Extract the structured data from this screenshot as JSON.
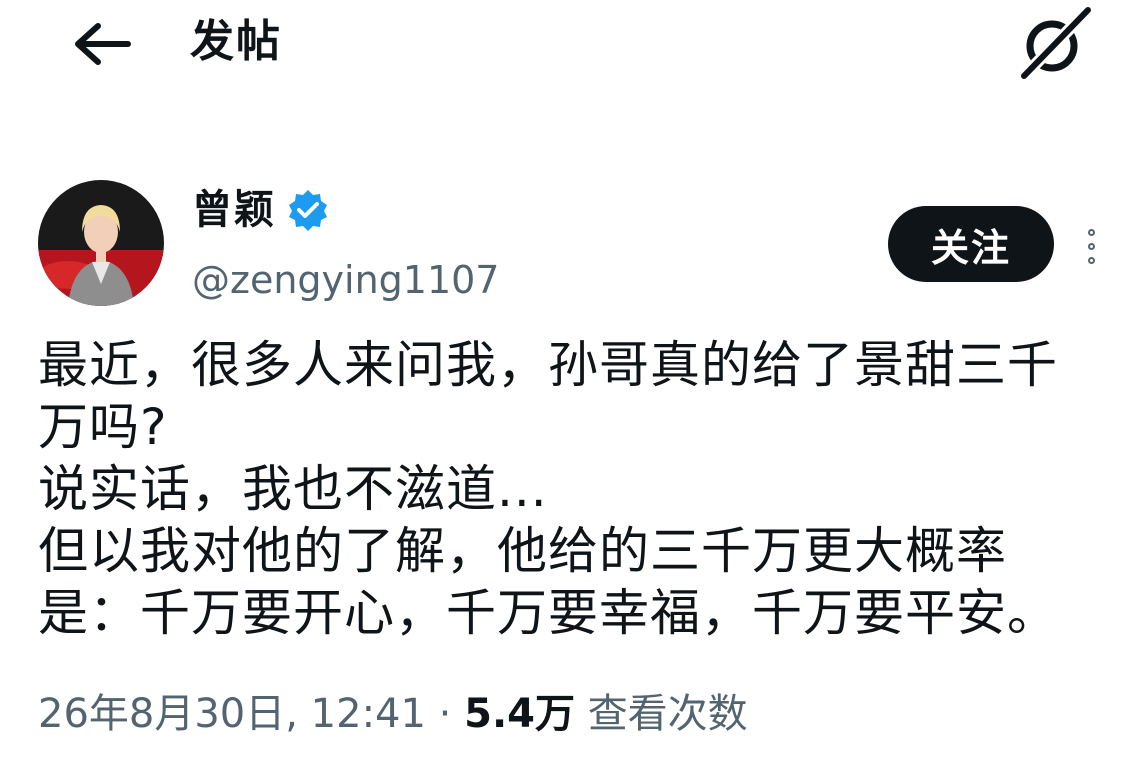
{
  "header": {
    "title": "发帖",
    "icons": {
      "back": "arrow-left-icon",
      "grok": "grok-icon"
    }
  },
  "author": {
    "name": "曾颖",
    "handle": "@zengying1107",
    "verified": true,
    "follow_label": "关注"
  },
  "post": {
    "lines": [
      "最近，很多人来问我，孙哥真的给了景甜三千",
      "万吗?",
      "说实话，我也不滋道...",
      "但以我对他的了解，他给的三千万更大概率",
      "是：千万要开心，千万要幸福，千万要平安。"
    ],
    "timestamp": "26年8月30日, 12:41",
    "separator": "·",
    "views_count": "5.4万",
    "views_label": "查看次数"
  },
  "colors": {
    "text": "#0f1419",
    "secondary": "#536471",
    "verified": "#1d9bf0",
    "button_bg": "#0f1419"
  }
}
